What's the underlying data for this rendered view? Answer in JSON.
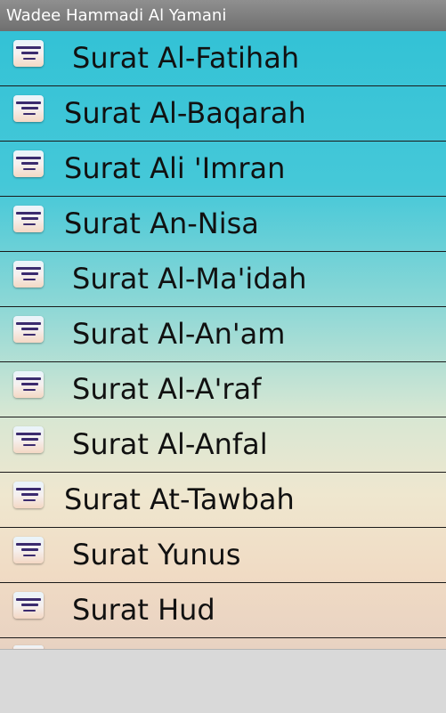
{
  "app": {
    "title": "Wadee Hammadi Al Yamani"
  },
  "list": {
    "items": [
      {
        "label": "Surat Al-Fatihah",
        "icon": "app-icon"
      },
      {
        "label": "Surat Al-Baqarah",
        "icon": "app-icon"
      },
      {
        "label": "Surat Ali 'Imran",
        "icon": "app-icon"
      },
      {
        "label": "Surat An-Nisa",
        "icon": "app-icon"
      },
      {
        "label": "Surat Al-Ma'idah",
        "icon": "app-icon"
      },
      {
        "label": "Surat Al-An'am",
        "icon": "app-icon"
      },
      {
        "label": "Surat Al-A'raf",
        "icon": "app-icon"
      },
      {
        "label": "Surat Al-Anfal",
        "icon": "app-icon"
      },
      {
        "label": "Surat At-Tawbah",
        "icon": "app-icon"
      },
      {
        "label": "Surat Yunus",
        "icon": "app-icon"
      },
      {
        "label": "Surat Hud",
        "icon": "app-icon"
      }
    ]
  },
  "colors": {
    "title_bar": "#7f7f7f",
    "list_top": "#33c2d6",
    "list_bottom": "#e8d2c2",
    "divider": "#1a1a1a"
  }
}
